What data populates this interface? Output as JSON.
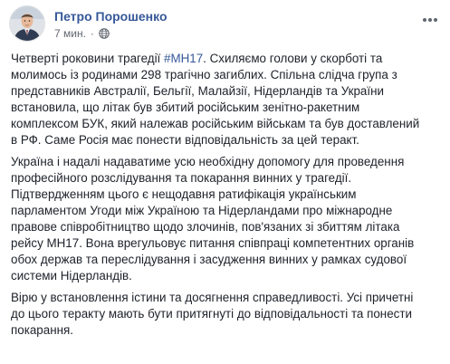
{
  "post": {
    "author": "Петро Порошенко",
    "time": "7 мин.",
    "separator": "·",
    "privacy_icon": "globe-icon",
    "options_icon": "ellipsis-icon",
    "avatar_icon": "profile-photo",
    "paragraphs": [
      {
        "before_tag": "Четверті роковини трагедії ",
        "hashtag": "#МН17",
        "after_tag": ". Схиляємо голови у скорботі та\nмолимось із родинами 298 трагічно загиблих. Спільна слідча група з\nпредставників Австралії, Бельгії, Малайзії, Нідерландів та України\nвстановила, що літак був збитий російським зенітно-ракетним\nкомплексом БУК, який належав російським військам та був доставлений\nв РФ. Саме Росія має понести відповідальність за цей теракт."
      },
      {
        "text": "Україна і надалі надаватиме усю необхідну допомогу для проведення\nпрофесійного розслідування та покарання винних у трагедії.\nПідтвердженням цього є нещодавня ратифікація українським\nпарламентом Угоди між Україною та Нідерландами про міжнародне\nправове співробітництво щодо злочинів, пов'язаних зі збиттям літака\nрейсу МН17. Вона врегульовує питання співпраці компетентних органів\nобох держав та переслідування і засудження винних у рамках судової\nсистеми Нідерландів."
      },
      {
        "text": "Вірю у встановлення істини та досягнення справедливості. Усі причетні\nдо цього теракту мають бути притягнуті до відповідальності та понести\nпокарання."
      }
    ]
  },
  "colors": {
    "author_link": "#365899",
    "meta_text": "#616770",
    "body_text": "#1d2129",
    "hashtag": "#365899"
  }
}
